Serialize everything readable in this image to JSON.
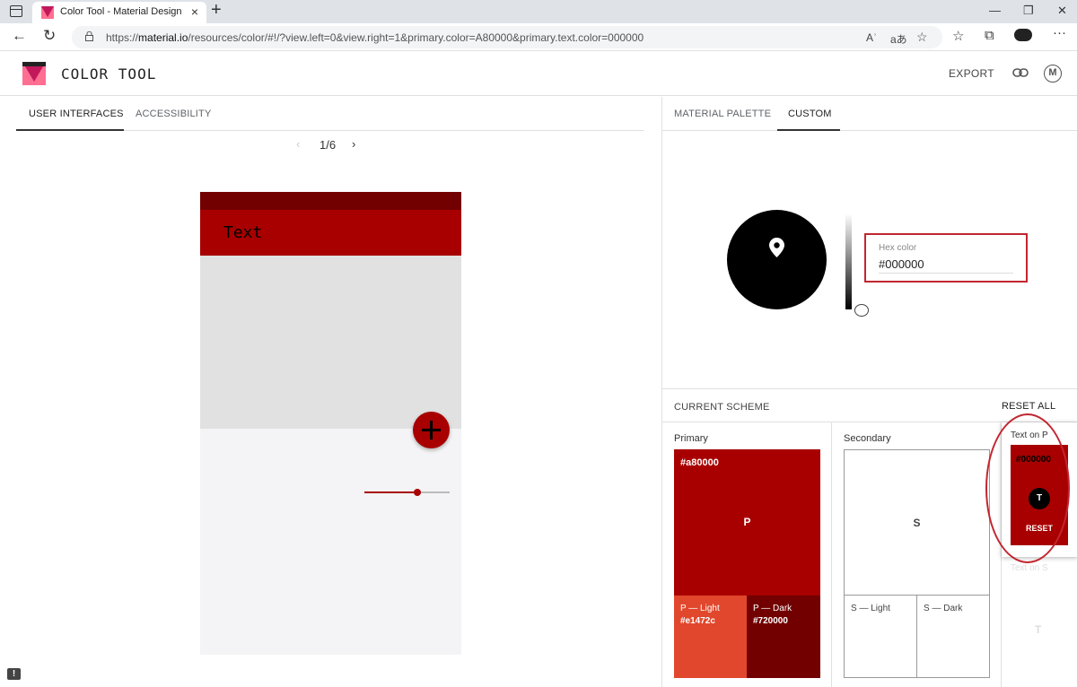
{
  "browser": {
    "tab_title": "Color Tool - Material Design",
    "url_prefix": "https://",
    "url_host": "material.io",
    "url_path": "/resources/color/#!/?view.left=0&view.right=1&primary.color=A80000&primary.text.color=000000",
    "read_aloud_label": "Aʾ",
    "translate_label": "aあ"
  },
  "appbar": {
    "title": "COLOR TOOL",
    "export_label": "EXPORT"
  },
  "left": {
    "tabs": [
      "USER INTERFACES",
      "ACCESSIBILITY"
    ],
    "pager": "1/6",
    "phone": {
      "toolbar_text": "Text",
      "slider_value": 0.62
    }
  },
  "right": {
    "tabs": [
      "MATERIAL PALETTE",
      "CUSTOM"
    ],
    "hex_label": "Hex color",
    "hex_value": "#000000",
    "scheme_title": "CURRENT SCHEME",
    "reset_all": "RESET ALL",
    "primary": {
      "label": "Primary",
      "hex": "#a80000",
      "letter": "P",
      "light_label": "P — Light",
      "light_hex": "#e1472c",
      "dark_label": "P — Dark",
      "dark_hex": "#720000"
    },
    "secondary": {
      "label": "Secondary",
      "letter": "S",
      "light_label": "S — Light",
      "dark_label": "S — Dark"
    },
    "text_on_p": {
      "label": "Text on P",
      "hex": "#000000",
      "letter": "T",
      "reset": "RESET"
    },
    "text_on_s": {
      "label": "Text on S",
      "letter": "T"
    }
  },
  "colors": {
    "primary": "#a80000",
    "primary_light": "#e1472c",
    "primary_dark": "#720000",
    "text_on_primary": "#000000",
    "annotation_red": "#c1262f"
  }
}
